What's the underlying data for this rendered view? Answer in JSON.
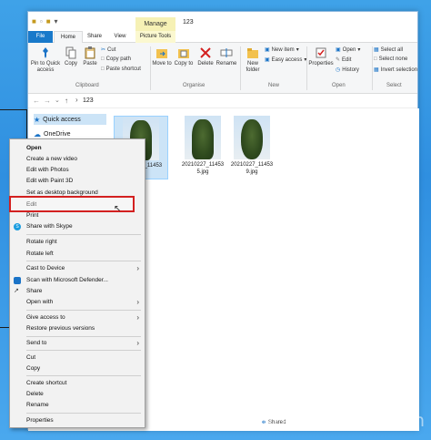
{
  "titlebar": {
    "title": "123",
    "manage_label": "Manage"
  },
  "tabs": {
    "file": "File",
    "home": "Home",
    "share": "Share",
    "view": "View",
    "picture_tools": "Picture Tools"
  },
  "ribbon": {
    "pin_to_quick": "Pin to Quick access",
    "copy": "Copy",
    "paste": "Paste",
    "cut": "Cut",
    "copy_path": "Copy path",
    "paste_shortcut": "Paste shortcut",
    "move_to": "Move to",
    "copy_to": "Copy to",
    "delete": "Delete",
    "rename": "Rename",
    "new_folder": "New folder",
    "new_item": "New item",
    "easy_access": "Easy access",
    "properties": "Properties",
    "open": "Open",
    "edit": "Edit",
    "history": "History",
    "select_all": "Select all",
    "select_none": "Select none",
    "invert_selection": "Invert selection",
    "groups": {
      "clipboard": "Clipboard",
      "organise": "Organise",
      "new": "New",
      "open": "Open",
      "select": "Select"
    }
  },
  "address": {
    "path": "123"
  },
  "nav": {
    "quick_access": "Quick access",
    "onedrive": "OneDrive"
  },
  "files": [
    {
      "name_line1": "20210227_11453",
      "name_line2": "",
      "selected": true
    },
    {
      "name_line1": "20210227_11453",
      "name_line2": "5.jpg"
    },
    {
      "name_line1": "20210227_11453",
      "name_line2": "9.jpg"
    }
  ],
  "status": {
    "shared": "Shared"
  },
  "context_menu": {
    "items": [
      {
        "label": "Open"
      },
      {
        "label": "Create a new video"
      },
      {
        "label": "Edit with Photos"
      },
      {
        "label": "Edit with Paint 3D"
      },
      {
        "label": "Set as desktop background"
      },
      {
        "label": "Edit"
      },
      {
        "label": "Print"
      },
      {
        "label": "Share with Skype"
      },
      {
        "label": "Rotate right"
      },
      {
        "label": "Rotate left"
      },
      {
        "label": "Cast to Device"
      },
      {
        "label": "Scan with Microsoft Defender..."
      },
      {
        "label": "Share"
      },
      {
        "label": "Open with"
      },
      {
        "label": "Give access to"
      },
      {
        "label": "Restore previous versions"
      },
      {
        "label": "Send to"
      },
      {
        "label": "Cut"
      },
      {
        "label": "Copy"
      },
      {
        "label": "Create shortcut"
      },
      {
        "label": "Delete"
      },
      {
        "label": "Rename"
      },
      {
        "label": "Properties"
      }
    ]
  },
  "watermark": "computersluggish.com",
  "colors": {
    "file_tab": "#1979ca",
    "highlight_box": "#d32020",
    "selected_bg": "#cce4f7",
    "manage_bg": "#f6f1b5"
  }
}
